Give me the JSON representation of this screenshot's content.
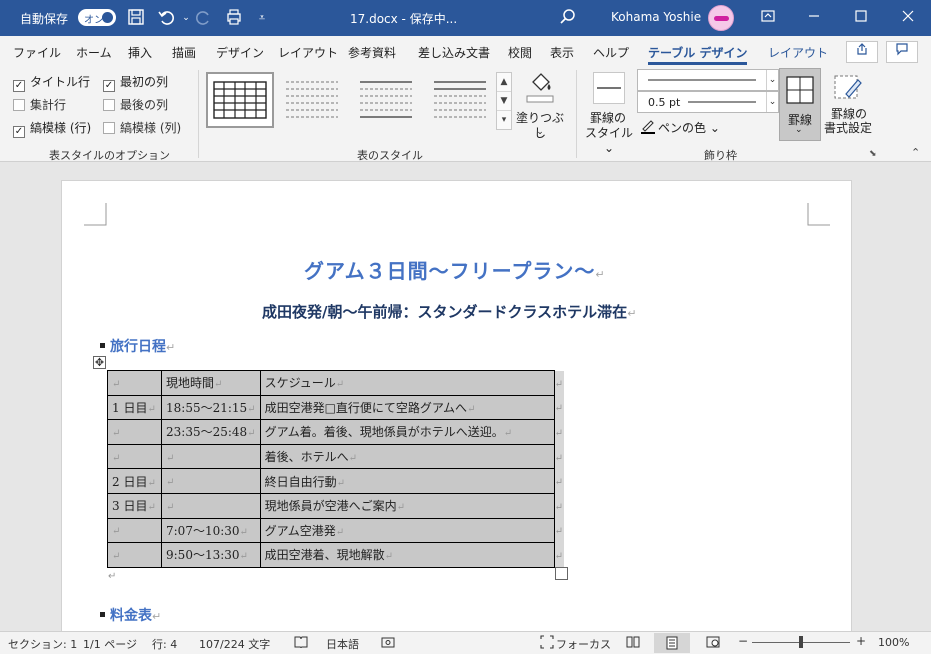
{
  "titlebar": {
    "autosave_label": "自動保存",
    "autosave_state": "オン",
    "doc_title": "17.docx - 保存中...",
    "user_name": "Kohama Yoshie"
  },
  "tabs": [
    "ファイル",
    "ホーム",
    "挿入",
    "描画",
    "デザイン",
    "レイアウト",
    "参考資料",
    "差し込み文書",
    "校閲",
    "表示",
    "ヘルプ",
    "テーブル デザイン",
    "レイアウト"
  ],
  "active_tab": "テーブル デザイン",
  "ribbon": {
    "options": {
      "label": "表スタイルのオプション",
      "header_row": "タイトル行",
      "first_column": "最初の列",
      "total_row": "集計行",
      "last_column": "最後の列",
      "banded_rows": "縞模様 (行)",
      "banded_columns": "縞模様 (列)",
      "checked": [
        "タイトル行",
        "最初の列",
        "縞模様 (行)"
      ]
    },
    "styles": {
      "label": "表のスタイル"
    },
    "shading": {
      "label": "塗りつぶし"
    },
    "borders": {
      "label": "飾り枠",
      "border_styles": "罫線の",
      "border_styles_2": "スタイル",
      "pen_weight": "0.5 pt",
      "pen_color": "ペンの色",
      "borders_button": "罫線",
      "border_painter_1": "罫線の",
      "border_painter_2": "書式設定"
    }
  },
  "document": {
    "title": "グアム３日間～フリープラン～",
    "subtitle": "成田夜発/朝～午前帰：スタンダードクラスホテル滞在",
    "heading1": "旅行日程",
    "heading2": "料金表",
    "table": [
      [
        "",
        "現地時間",
        "スケジュール"
      ],
      [
        "1 日目",
        "18:55～21:15",
        "成田空港発□直行便にて空路グアムへ"
      ],
      [
        "",
        "23:35～25:48",
        "グアム着。着後、現地係員がホテルへ送迎。"
      ],
      [
        "",
        "",
        "着後、ホテルへ"
      ],
      [
        "2 日目",
        "",
        "終日自由行動"
      ],
      [
        "3 日目",
        "",
        "現地係員が空港へご案内"
      ],
      [
        "",
        "7:07～10:30",
        "グアム空港発"
      ],
      [
        "",
        "9:50～13:30",
        "成田空港着、現地解散"
      ]
    ]
  },
  "statusbar": {
    "section": "セクション: 1",
    "page": "1/1 ページ",
    "line": "行: 4",
    "words": "107/224 文字",
    "language": "日本語",
    "focus": "フォーカス",
    "zoom": "100%"
  },
  "colors": {
    "accent": "#2b579a",
    "heading": "#4472c4",
    "subtitle": "#1f3864",
    "table_fill": "#c8c8c8"
  }
}
